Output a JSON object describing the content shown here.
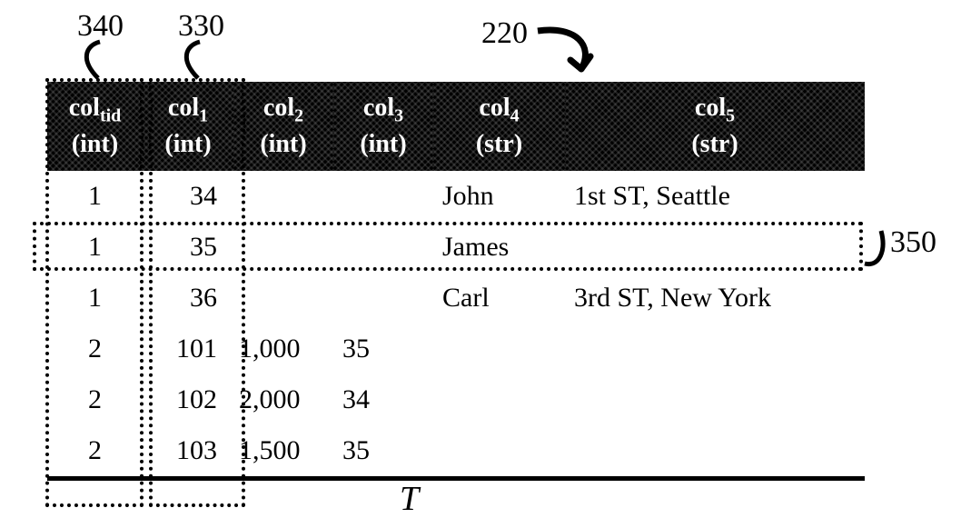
{
  "annotations": {
    "col_tid_box_label": "340",
    "col1_box_label": "330",
    "table_ref_label": "220",
    "row_box_label": "350"
  },
  "table": {
    "caption": "T",
    "headers": {
      "c0": {
        "name": "col",
        "sub": "tid",
        "type": "(int)"
      },
      "c1": {
        "name": "col",
        "sub": "1",
        "type": "(int)"
      },
      "c2": {
        "name": "col",
        "sub": "2",
        "type": "(int)"
      },
      "c3": {
        "name": "col",
        "sub": "3",
        "type": "(int)"
      },
      "c4": {
        "name": "col",
        "sub": "4",
        "type": "(str)"
      },
      "c5": {
        "name": "col",
        "sub": "5",
        "type": "(str)"
      }
    },
    "rows": [
      {
        "tid": "1",
        "c1": "34",
        "c2": "",
        "c3": "",
        "c4": "John",
        "c5": "1st ST, Seattle"
      },
      {
        "tid": "1",
        "c1": "35",
        "c2": "",
        "c3": "",
        "c4": "James",
        "c5": ""
      },
      {
        "tid": "1",
        "c1": "36",
        "c2": "",
        "c3": "",
        "c4": "Carl",
        "c5": "3rd ST, New York"
      },
      {
        "tid": "2",
        "c1": "101",
        "c2": "1,000",
        "c3": "35",
        "c4": "",
        "c5": ""
      },
      {
        "tid": "2",
        "c1": "102",
        "c2": "2,000",
        "c3": "34",
        "c4": "",
        "c5": ""
      },
      {
        "tid": "2",
        "c1": "103",
        "c2": "1,500",
        "c3": "35",
        "c4": "",
        "c5": ""
      }
    ]
  }
}
